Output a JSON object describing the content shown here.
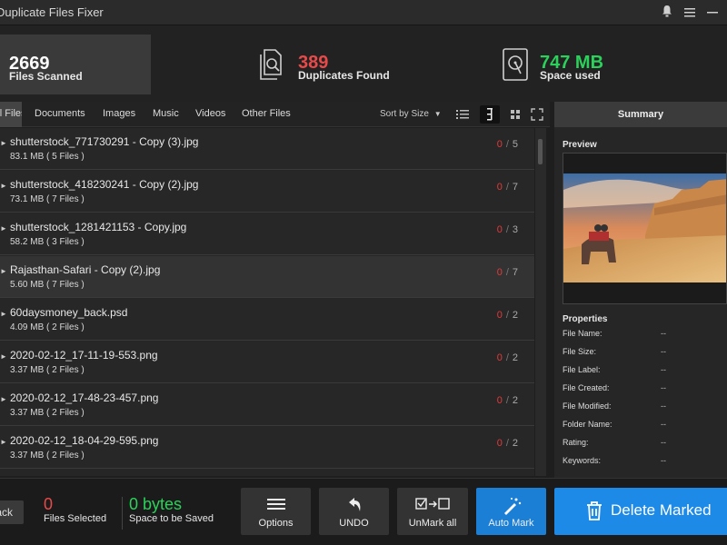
{
  "app": {
    "title": "Duplicate Files Fixer"
  },
  "stats": {
    "scanned": {
      "value": "2669",
      "label": "Files Scanned"
    },
    "duplicates": {
      "value": "389",
      "label": "Duplicates Found"
    },
    "space": {
      "value": "747 MB",
      "label": "Space used"
    }
  },
  "tabs": {
    "all": "All Files",
    "documents": "Documents",
    "images": "Images",
    "music": "Music",
    "videos": "Videos",
    "other": "Other Files"
  },
  "sort": {
    "label": "Sort by Size"
  },
  "files": [
    {
      "name": "shutterstock_771730291 - Copy (3).jpg",
      "meta": "83.1 MB  ( 5 Files )",
      "marked": "0",
      "total": "5"
    },
    {
      "name": "shutterstock_418230241 - Copy (2).jpg",
      "meta": "73.1 MB  ( 7 Files )",
      "marked": "0",
      "total": "7"
    },
    {
      "name": "shutterstock_1281421153 - Copy.jpg",
      "meta": "58.2 MB  ( 3 Files )",
      "marked": "0",
      "total": "3"
    },
    {
      "name": "Rajasthan-Safari - Copy (2).jpg",
      "meta": "5.60 MB  ( 7 Files )",
      "marked": "0",
      "total": "7"
    },
    {
      "name": "60daysmoney_back.psd",
      "meta": "4.09 MB  ( 2 Files )",
      "marked": "0",
      "total": "2"
    },
    {
      "name": "2020-02-12_17-11-19-553.png",
      "meta": "3.37 MB  ( 2 Files )",
      "marked": "0",
      "total": "2"
    },
    {
      "name": "2020-02-12_17-48-23-457.png",
      "meta": "3.37 MB  ( 2 Files )",
      "marked": "0",
      "total": "2"
    },
    {
      "name": "2020-02-12_18-04-29-595.png",
      "meta": "3.37 MB  ( 2 Files )",
      "marked": "0",
      "total": "2"
    }
  ],
  "summary": {
    "title": "Summary",
    "preview_label": "Preview",
    "properties_label": "Properties",
    "properties": [
      {
        "key": "File Name:",
        "value": "--"
      },
      {
        "key": "File Size:",
        "value": "--"
      },
      {
        "key": "File Label:",
        "value": "--"
      },
      {
        "key": "File Created:",
        "value": "--"
      },
      {
        "key": "File Modified:",
        "value": "--"
      },
      {
        "key": "Folder Name:",
        "value": "--"
      },
      {
        "key": "Rating:",
        "value": "--"
      },
      {
        "key": "Keywords:",
        "value": "--"
      }
    ]
  },
  "bottom": {
    "back_label": "Back",
    "files_selected": {
      "value": "0",
      "label": "Files Selected"
    },
    "space_saved": {
      "value": "0 bytes",
      "label": "Space to be Saved"
    },
    "options_label": "Options",
    "undo_label": "UNDO",
    "unmark_label": "UnMark all",
    "automark_label": "Auto Mark",
    "delete_label": "Delete Marked"
  },
  "colors": {
    "accent_blue": "#1d8ae8",
    "duplicates_red": "#e84a4a",
    "space_green": "#2bd15a"
  }
}
